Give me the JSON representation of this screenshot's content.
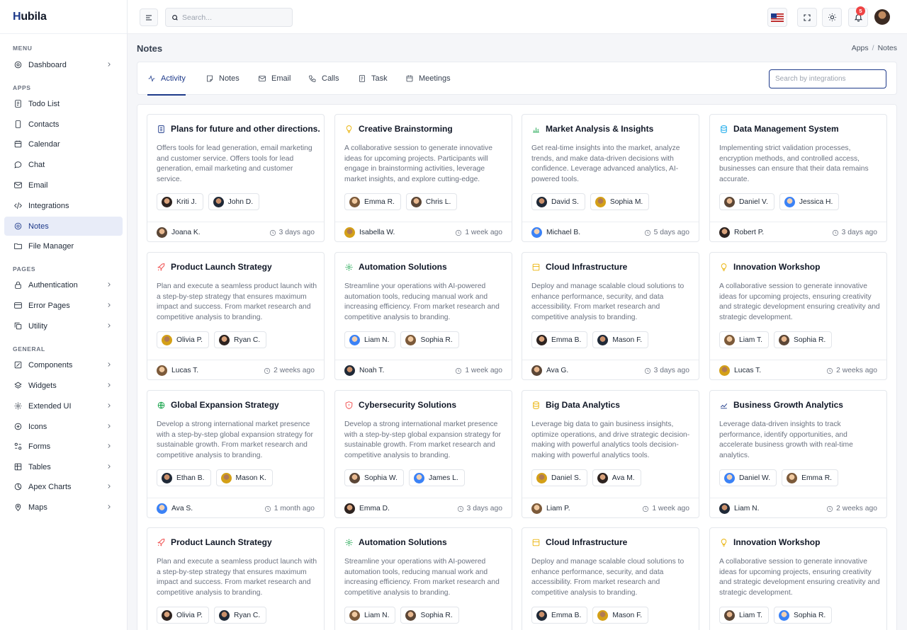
{
  "app": {
    "brand": "Hubila"
  },
  "sidebar": {
    "sections": {
      "menu": "MENU",
      "apps": "APPS",
      "pages": "PAGES",
      "general": "GENERAL"
    },
    "items": [
      {
        "label": "Dashboard",
        "icon": "dashboard-icon"
      },
      {
        "label": "Todo List",
        "icon": "todo-icon"
      },
      {
        "label": "Contacts",
        "icon": "contacts-icon"
      },
      {
        "label": "Calendar",
        "icon": "calendar-icon"
      },
      {
        "label": "Chat",
        "icon": "chat-icon"
      },
      {
        "label": "Email",
        "icon": "email-icon"
      },
      {
        "label": "Integrations",
        "icon": "code-icon"
      },
      {
        "label": "Notes",
        "icon": "notes-icon"
      },
      {
        "label": "File Manager",
        "icon": "folder-icon"
      },
      {
        "label": "Authentication",
        "icon": "lock-icon"
      },
      {
        "label": "Error Pages",
        "icon": "error-icon"
      },
      {
        "label": "Utility",
        "icon": "copy-icon"
      },
      {
        "label": "Components",
        "icon": "components-icon"
      },
      {
        "label": "Widgets",
        "icon": "widgets-icon"
      },
      {
        "label": "Extended UI",
        "icon": "extended-icon"
      },
      {
        "label": "Icons",
        "icon": "icons-icon"
      },
      {
        "label": "Forms",
        "icon": "forms-icon"
      },
      {
        "label": "Tables",
        "icon": "table-icon"
      },
      {
        "label": "Apex Charts",
        "icon": "chart-icon"
      },
      {
        "label": "Maps",
        "icon": "map-pin-icon"
      }
    ]
  },
  "topbar": {
    "search_placeholder": "Search...",
    "notification_count": "5"
  },
  "page": {
    "title": "Notes",
    "breadcrumb": [
      "Apps",
      "Notes"
    ]
  },
  "tabs": [
    {
      "label": "Activity",
      "icon": "activity-icon"
    },
    {
      "label": "Notes",
      "icon": "note-icon"
    },
    {
      "label": "Email",
      "icon": "email-icon"
    },
    {
      "label": "Calls",
      "icon": "phone-icon"
    },
    {
      "label": "Task",
      "icon": "task-icon"
    },
    {
      "label": "Meetings",
      "icon": "calendar-icon"
    }
  ],
  "integration_search_placeholder": "Search by integrations",
  "colors": {
    "primary": "#1e3a8a",
    "active_bg": "#e8ecf8",
    "danger": "#ef4444"
  },
  "notes": [
    {
      "title": "Plans for future and other directions.",
      "icon": "document-icon",
      "icon_color": "#1e3a8a",
      "desc": "Offers tools for lead generation, email marketing and customer service. Offers tools for lead generation, email marketing and customer service.",
      "people": [
        "Kriti J.",
        "John D."
      ],
      "owner": "Joana K.",
      "time": "3 days ago"
    },
    {
      "title": "Creative Brainstorming",
      "icon": "bulb-icon",
      "icon_color": "#eab308",
      "desc": "A collaborative session to generate innovative ideas for upcoming projects. Participants will engage in brainstorming activities, leverage market insights, and explore cutting-edge.",
      "people": [
        "Emma R.",
        "Chris L."
      ],
      "owner": "Isabella W.",
      "time": "1 week ago"
    },
    {
      "title": "Market Analysis & Insights",
      "icon": "bar-chart-icon",
      "icon_color": "#16a34a",
      "desc": "Get real-time insights into the market, analyze trends, and make data-driven decisions with confidence. Leverage advanced analytics, AI-powered tools.",
      "people": [
        "David S.",
        "Sophia M."
      ],
      "owner": "Michael B.",
      "time": "5 days ago"
    },
    {
      "title": "Data Management System",
      "icon": "database-icon",
      "icon_color": "#0ea5e9",
      "desc": "Implementing strict validation processes, encryption methods, and controlled access, businesses can ensure that their data remains accurate.",
      "people": [
        "Daniel V.",
        "Jessica H."
      ],
      "owner": "Robert P.",
      "time": "3 days ago"
    },
    {
      "title": "Product Launch Strategy",
      "icon": "rocket-icon",
      "icon_color": "#ef4444",
      "desc": "Plan and execute a seamless product launch with a step-by-step strategy that ensures maximum impact and success. From market research and competitive analysis to branding.",
      "people": [
        "Olivia P.",
        "Ryan C."
      ],
      "owner": "Lucas T.",
      "time": "2 weeks ago"
    },
    {
      "title": "Automation Solutions",
      "icon": "gear-icon",
      "icon_color": "#16a34a",
      "desc": "Streamline your operations with AI-powered automation tools, reducing manual work and increasing efficiency. From market research and competitive analysis to branding.",
      "people": [
        "Liam N.",
        "Sophia R."
      ],
      "owner": "Noah T.",
      "time": "1 week ago"
    },
    {
      "title": "Cloud Infrastructure",
      "icon": "server-icon",
      "icon_color": "#eab308",
      "desc": "Deploy and manage scalable cloud solutions to enhance performance, security, and data accessibility. From market research and competitive analysis to branding.",
      "people": [
        "Emma B.",
        "Mason F."
      ],
      "owner": "Ava G.",
      "time": "3 days ago"
    },
    {
      "title": "Innovation Workshop",
      "icon": "bulb-icon",
      "icon_color": "#eab308",
      "desc": "A collaborative session to generate innovative ideas for upcoming projects, ensuring creativity and strategic development ensuring creativity and strategic development.",
      "people": [
        "Liam T.",
        "Sophia R."
      ],
      "owner": "Lucas T.",
      "time": "2 weeks ago"
    },
    {
      "title": "Global Expansion Strategy",
      "icon": "globe-icon",
      "icon_color": "#16a34a",
      "desc": "Develop a strong international market presence with a step-by-step global expansion strategy for sustainable growth. From market research and competitive analysis to branding.",
      "people": [
        "Ethan B.",
        "Mason K."
      ],
      "owner": "Ava S.",
      "time": "1 month ago"
    },
    {
      "title": "Cybersecurity Solutions",
      "icon": "shield-icon",
      "icon_color": "#ef4444",
      "desc": "Develop a strong international market presence with a step-by-step global expansion strategy for sustainable growth. From market research and competitive analysis to branding.",
      "people": [
        "Sophia W.",
        "James L."
      ],
      "owner": "Emma D.",
      "time": "3 days ago"
    },
    {
      "title": "Big Data Analytics",
      "icon": "database-icon",
      "icon_color": "#eab308",
      "desc": "Leverage big data to gain business insights, optimize operations, and drive strategic decision-making with powerful analytics tools decision-making with powerful analytics tools.",
      "people": [
        "Daniel S.",
        "Ava M."
      ],
      "owner": "Liam P.",
      "time": "1 week ago"
    },
    {
      "title": "Business Growth Analytics",
      "icon": "trend-icon",
      "icon_color": "#1e3a8a",
      "desc": "Leverage data-driven insights to track performance, identify opportunities, and accelerate business growth with real-time analytics.",
      "people": [
        "Daniel W.",
        "Emma R."
      ],
      "owner": "Liam N.",
      "time": "2 weeks ago"
    },
    {
      "title": "Product Launch Strategy",
      "icon": "rocket-icon",
      "icon_color": "#ef4444",
      "desc": "Plan and execute a seamless product launch with a step-by-step strategy that ensures maximum impact and success. From market research and competitive analysis to branding.",
      "people": [
        "Olivia P.",
        "Ryan C."
      ],
      "owner": "",
      "time": ""
    },
    {
      "title": "Automation Solutions",
      "icon": "gear-icon",
      "icon_color": "#16a34a",
      "desc": "Streamline your operations with AI-powered automation tools, reducing manual work and increasing efficiency. From market research and competitive analysis to branding.",
      "people": [
        "Liam N.",
        "Sophia R."
      ],
      "owner": "",
      "time": ""
    },
    {
      "title": "Cloud Infrastructure",
      "icon": "server-icon",
      "icon_color": "#eab308",
      "desc": "Deploy and manage scalable cloud solutions to enhance performance, security, and data accessibility. From market research and competitive analysis to branding.",
      "people": [
        "Emma B.",
        "Mason F."
      ],
      "owner": "",
      "time": ""
    },
    {
      "title": "Innovation Workshop",
      "icon": "bulb-icon",
      "icon_color": "#eab308",
      "desc": "A collaborative session to generate innovative ideas for upcoming projects, ensuring creativity and strategic development ensuring creativity and strategic development.",
      "people": [
        "Liam T.",
        "Sophia R."
      ],
      "owner": "",
      "time": ""
    }
  ]
}
